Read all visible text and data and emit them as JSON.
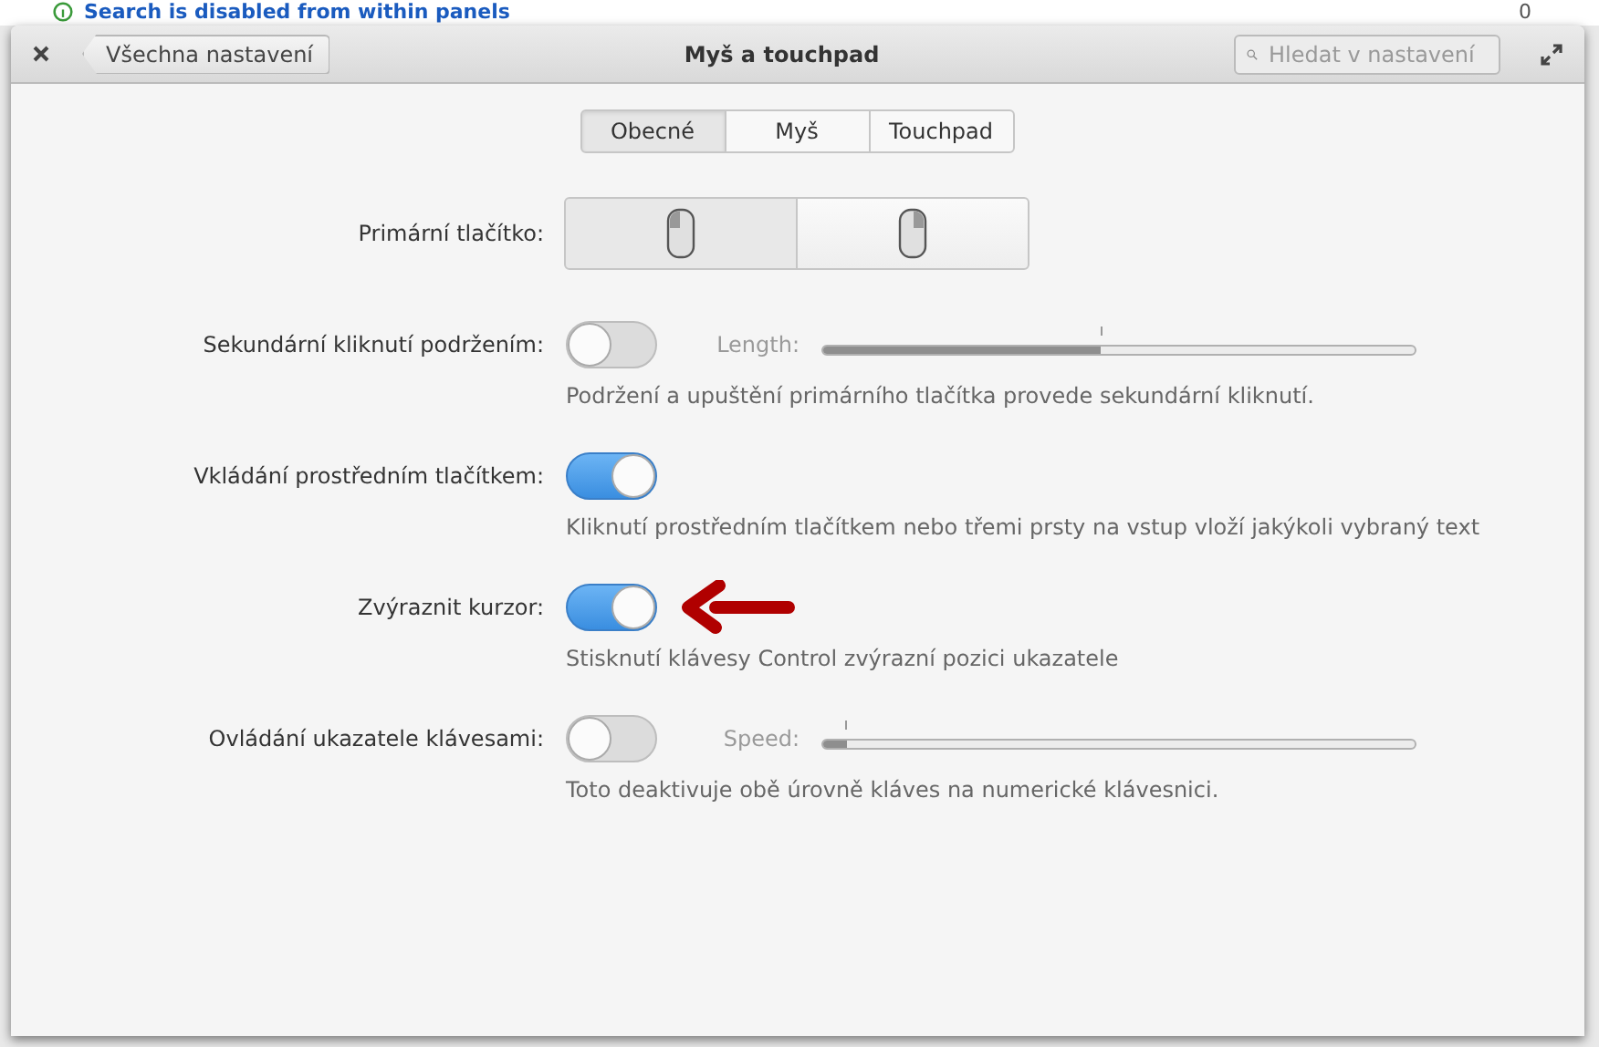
{
  "background": {
    "notice": "Search is disabled from within panels",
    "count": "0"
  },
  "window": {
    "title": "Myš a touchpad",
    "back_button": "Všechna nastavení",
    "search": {
      "placeholder": "Hledat v nastavení"
    }
  },
  "tabs": [
    {
      "label": "Obecné",
      "selected": true
    },
    {
      "label": "Myš",
      "selected": false
    },
    {
      "label": "Touchpad",
      "selected": false
    }
  ],
  "primary_button": {
    "label": "Primární tlačítko:",
    "options": [
      {
        "kind": "left",
        "selected": true
      },
      {
        "kind": "right",
        "selected": false
      }
    ]
  },
  "settings": [
    {
      "label": "Sekundární kliknutí podržením:",
      "on": false,
      "slider_label": "Length:",
      "level": 0.47,
      "description": "Podržení a upuštění primárního tlačítka provede sekundární kliknutí."
    },
    {
      "label": "Vkládání prostředním tlačítkem:",
      "on": true,
      "description": "Kliknutí prostředním tlačítkem nebo třemi prsty na vstup vloží jakýkoli vybraný text"
    },
    {
      "label": "Zvýraznit kurzor:",
      "on": true,
      "annotated": true,
      "description": "Stisknutí klávesy Control zvýrazní pozici ukazatele"
    },
    {
      "label": "Ovládání ukazatele klávesami:",
      "on": false,
      "slider_label": "Speed:",
      "level": 0.04,
      "description": "Toto deaktivuje obě úrovně kláves na numerické klávesnici."
    }
  ]
}
